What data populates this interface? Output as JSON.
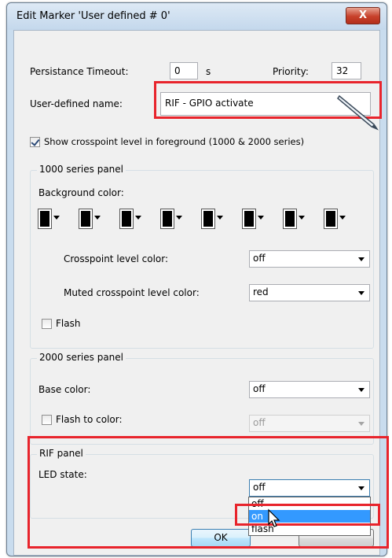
{
  "window": {
    "title": "Edit Marker 'User defined # 0'",
    "close_label": "X"
  },
  "persistance": {
    "label": "Persistance Timeout:",
    "value": "0",
    "unit": "s"
  },
  "priority": {
    "label": "Priority:",
    "value": "32"
  },
  "user_name": {
    "label": "User-defined name:",
    "value": "RIF - GPIO activate"
  },
  "show_crosspoint": {
    "label": "Show crosspoint level in foreground (1000 & 2000 series)",
    "checked": true
  },
  "panel1000": {
    "title": "1000 series panel",
    "background_label": "Background color:",
    "swatches": [
      "black",
      "black",
      "black",
      "black",
      "black",
      "black",
      "black",
      "black"
    ],
    "crosspoint_label": "Crosspoint level color:",
    "crosspoint_value": "off",
    "muted_label": "Muted crosspoint level color:",
    "muted_value": "red",
    "flash_label": "Flash"
  },
  "panel2000": {
    "title": "2000 series panel",
    "base_label": "Base color:",
    "base_value": "off",
    "flash_to_label": "Flash to color:",
    "flash_to_value": "off"
  },
  "rif": {
    "title": "RIF panel",
    "led_label": "LED state:",
    "led_value": "off",
    "options": [
      "off",
      "on",
      "flash"
    ],
    "selected_option": "on"
  },
  "buttons": {
    "ok": "OK",
    "cancel": ""
  },
  "colors": {
    "highlight": "#e8242c",
    "selection": "#3399ff"
  }
}
